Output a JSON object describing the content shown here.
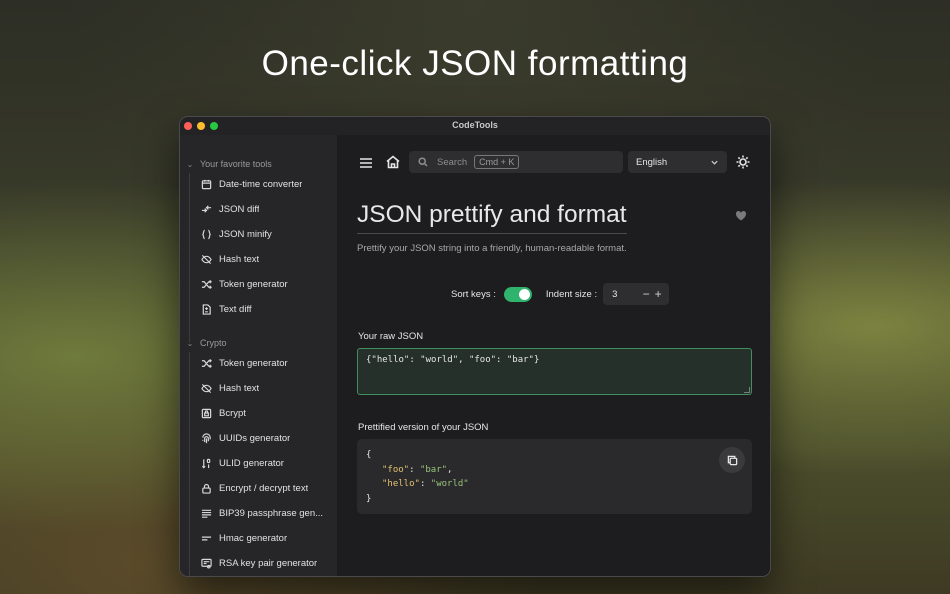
{
  "headline": "One-click JSON formatting",
  "window": {
    "title": "CodeTools"
  },
  "sidebar": {
    "groups": [
      {
        "title": "Your favorite tools",
        "items": [
          {
            "label": "Date-time converter",
            "icon": "calendar-icon"
          },
          {
            "label": "JSON diff",
            "icon": "diff-arrows-icon"
          },
          {
            "label": "JSON minify",
            "icon": "braces-icon"
          },
          {
            "label": "Hash text",
            "icon": "eye-slash-icon"
          },
          {
            "label": "Token generator",
            "icon": "shuffle-icon"
          },
          {
            "label": "Text diff",
            "icon": "file-diff-icon"
          }
        ]
      },
      {
        "title": "Crypto",
        "items": [
          {
            "label": "Token generator",
            "icon": "shuffle-icon"
          },
          {
            "label": "Hash text",
            "icon": "eye-slash-icon"
          },
          {
            "label": "Bcrypt",
            "icon": "lock-box-icon"
          },
          {
            "label": "UUIDs generator",
            "icon": "fingerprint-icon"
          },
          {
            "label": "ULID generator",
            "icon": "sort-numeric-icon"
          },
          {
            "label": "Encrypt / decrypt text",
            "icon": "lock-icon"
          },
          {
            "label": "BIP39 passphrase gen...",
            "icon": "align-left-icon"
          },
          {
            "label": "Hmac generator",
            "icon": "short-text-icon"
          },
          {
            "label": "RSA key pair generator",
            "icon": "certificate-icon"
          }
        ]
      }
    ]
  },
  "toolbar": {
    "search_placeholder": "Search",
    "search_shortcut": "Cmd + K",
    "language": "English"
  },
  "page": {
    "title": "JSON prettify and format",
    "subtitle": "Prettify your JSON string into a friendly, human-readable format.",
    "sort_keys_label": "Sort keys :",
    "sort_keys_enabled": true,
    "indent_label": "Indent size :",
    "indent_value": "3",
    "raw_label": "Your raw JSON",
    "raw_value": "{\"hello\": \"world\", \"foo\": \"bar\"}",
    "pretty_label": "Prettified version of your JSON",
    "pretty": {
      "open": "{",
      "lines": [
        {
          "key": "\"foo\"",
          "sep": ": ",
          "value": "\"bar\"",
          "end": ","
        },
        {
          "key": "\"hello\"",
          "sep": ": ",
          "value": "\"world\"",
          "end": ""
        }
      ],
      "close": "}"
    }
  },
  "colors": {
    "accent": "#2fb36d",
    "json_key": "#e3c16f",
    "json_string": "#98c379"
  }
}
